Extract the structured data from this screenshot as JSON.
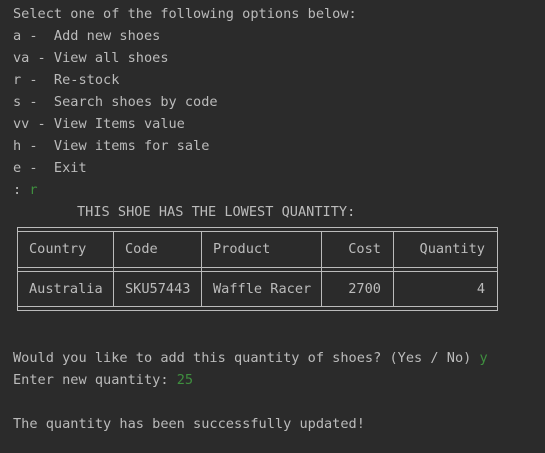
{
  "menu": {
    "prompt": "Select one of the following options below:",
    "options": [
      "a -  Add new shoes",
      "va - View all shoes",
      "r -  Re-stock",
      "s -  Search shoes by code",
      "vv - View Items value",
      "h -  View items for sale",
      "e -  Exit"
    ],
    "input_prefix": ": ",
    "input_value": "r"
  },
  "lowest_title": "THIS SHOE HAS THE LOWEST QUANTITY:",
  "table": {
    "headers": [
      "Country",
      "Code",
      "Product",
      "Cost",
      "Quantity"
    ],
    "row": [
      "Australia",
      "SKU57443",
      "Waffle Racer",
      "2700",
      "4"
    ]
  },
  "confirm": {
    "question": "Would you like to add this quantity of shoes? (Yes / No) ",
    "answer": "y"
  },
  "quantity": {
    "label": "Enter new quantity: ",
    "value": "25"
  },
  "result": "The quantity has been successfully updated!",
  "colors": {
    "background": "#2b2b2b",
    "text": "#bbbbbb",
    "user_input": "#3f8f3f"
  }
}
